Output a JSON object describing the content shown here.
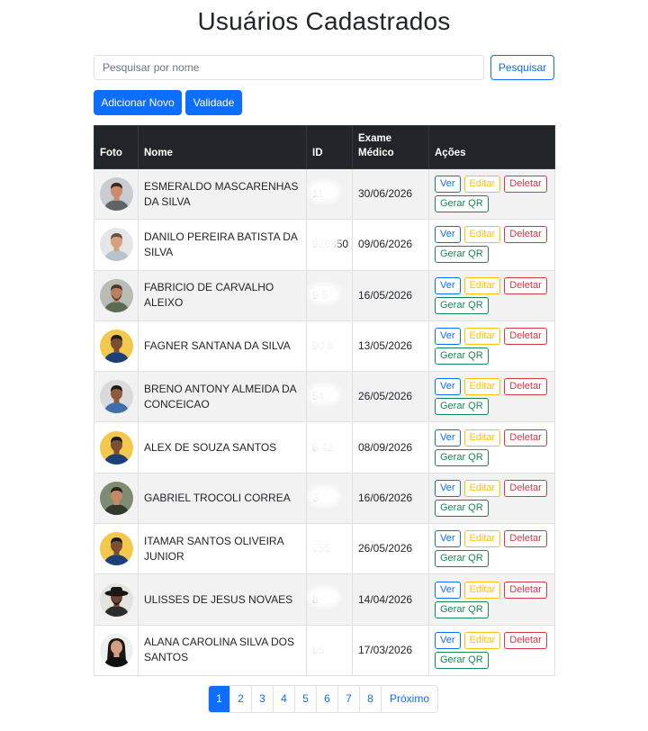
{
  "page": {
    "title": "Usuários Cadastrados"
  },
  "search": {
    "placeholder": "Pesquisar por nome",
    "value": "",
    "button_label": "Pesquisar"
  },
  "actions": {
    "add_label": "Adicionar Novo",
    "validade_label": "Validade"
  },
  "table": {
    "headers": {
      "foto": "Foto",
      "nome": "Nome",
      "id": "ID",
      "exame": "Exame Médico",
      "acoes": "Ações"
    },
    "action_labels": {
      "ver": "Ver",
      "editar": "Editar",
      "deletar": "Deletar",
      "qr": "Gerar QR"
    },
    "rows": [
      {
        "nome": "ESMERALDO MASCARENHAS DA SILVA",
        "id": "11",
        "exame": "30/06/2026",
        "avatar": "man-gray-shirt"
      },
      {
        "nome": "DANILO PEREIRA BATISTA DA SILVA",
        "id": "926850",
        "exame": "09/06/2026",
        "avatar": "man-light-shirt"
      },
      {
        "nome": "FABRICIO DE CARVALHO ALEIXO",
        "id": "9 5",
        "exame": "16/05/2026",
        "avatar": "bearded-man"
      },
      {
        "nome": "FAGNER SANTANA DA SILVA",
        "id": "90 6",
        "exame": "13/05/2026",
        "avatar": "man-yellow-backdrop"
      },
      {
        "nome": "BRENO ANTONY ALMEIDA DA CONCEICAO",
        "id": "54",
        "exame": "26/05/2026",
        "avatar": "man-blue-shirt"
      },
      {
        "nome": "ALEX DE SOUZA SANTOS",
        "id": "8 42",
        "exame": "08/09/2026",
        "avatar": "man-yellow-backdrop"
      },
      {
        "nome": "GABRIEL TROCOLI CORREA",
        "id": "3",
        "exame": "16/06/2026",
        "avatar": "man-dark-shirt"
      },
      {
        "nome": "ITAMAR SANTOS OLIVEIRA JUNIOR",
        "id": "755",
        "exame": "26/05/2026",
        "avatar": "man-yellow-backdrop"
      },
      {
        "nome": "ULISSES DE JESUS NOVAES",
        "id": "8",
        "exame": "14/04/2026",
        "avatar": "man-cowboy-hat"
      },
      {
        "nome": "ALANA CAROLINA SILVA DOS SANTOS",
        "id": "85",
        "exame": "17/03/2026",
        "avatar": "woman-dark-hair"
      }
    ]
  },
  "pagination": {
    "pages": [
      "1",
      "2",
      "3",
      "4",
      "5",
      "6",
      "7",
      "8"
    ],
    "active": "1",
    "next_label": "Próximo"
  },
  "colors": {
    "primary": "#0d6efd",
    "warning": "#ffc107",
    "danger": "#dc3545",
    "success": "#198754",
    "header_bg": "#212529",
    "stripe": "#f2f2f2"
  }
}
